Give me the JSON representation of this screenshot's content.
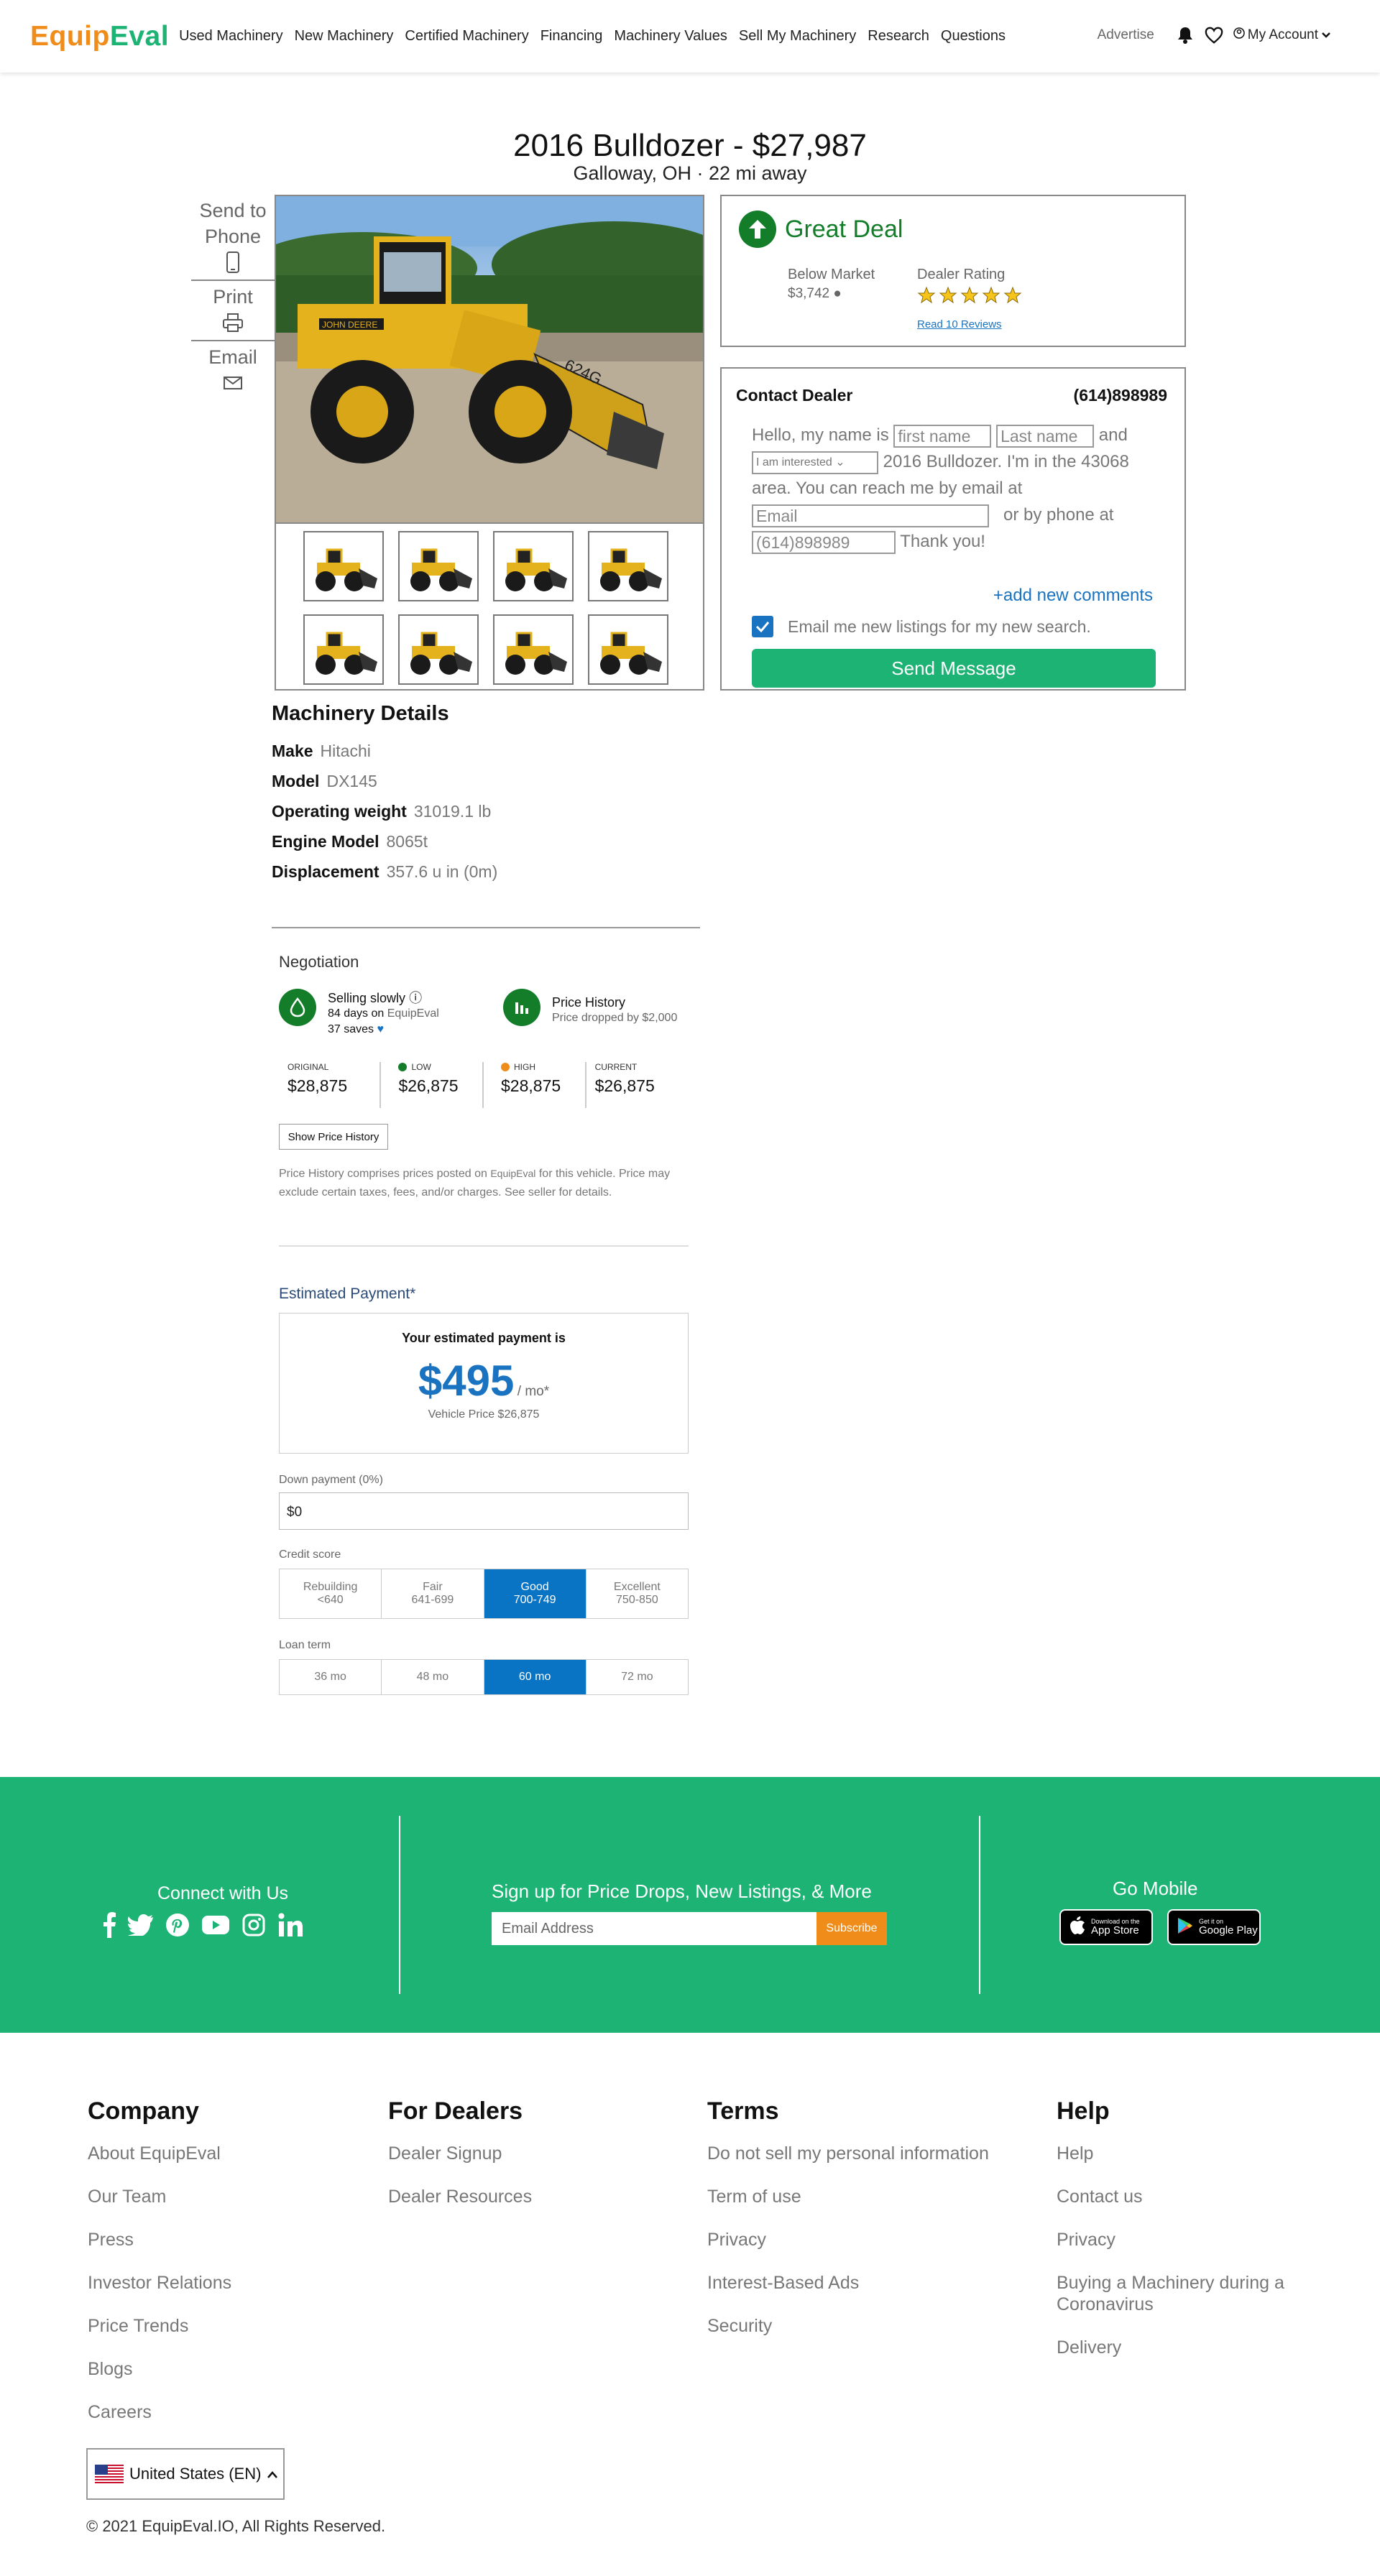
{
  "header": {
    "logo_part1": "Equip",
    "logo_part2": "Eval",
    "nav": [
      "Used Machinery",
      "New Machinery",
      "Certified Machinery",
      "Financing",
      "Machinery Values",
      "Sell My Machinery",
      "Research",
      "Questions"
    ],
    "advertise": "Advertise",
    "account": "My Account"
  },
  "listing": {
    "title": "2016 Bulldozer - $27,987",
    "location": "Galloway, OH · 22 mi away"
  },
  "share": {
    "send_to_phone": "Send to Phone",
    "print": "Print",
    "email": "Email"
  },
  "deal": {
    "label": "Great Deal",
    "below_market_label": "Below Market",
    "below_market_value": "$3,742",
    "dealer_rating_label": "Dealer Rating",
    "rating_stars": 5,
    "reviews_link": "Read 10 Reviews"
  },
  "contact": {
    "heading": "Contact Dealer",
    "phone": "(614)898989",
    "msg_hello": "Hello, my name is",
    "first_name_placeholder": "first name",
    "last_name_placeholder": "Last name",
    "msg_and": "and",
    "interest_select": "I am interested",
    "msg_body": "2016 Bulldozer. I'm in the 43068 area. You can reach me by email at",
    "email_placeholder": "Email",
    "msg_phone": "or by phone at",
    "phone_value": "(614)898989",
    "msg_thanks": "Thank you!",
    "add_comments": "+add new comments",
    "checkbox_label": "Email me new listings for my new search.",
    "send_button": "Send Message"
  },
  "details": {
    "heading": "Machinery Details",
    "rows": [
      {
        "label": "Make",
        "value": "Hitachi"
      },
      {
        "label": "Model",
        "value": "DX145"
      },
      {
        "label": "Operating weight",
        "value": "31019.1 lb"
      },
      {
        "label": "Engine Model",
        "value": "8065t"
      },
      {
        "label": "Displacement",
        "value": "357.6 u in (0m)"
      }
    ]
  },
  "negotiation": {
    "heading": "Negotiation",
    "selling_title": "Selling slowly",
    "selling_days": "84 days",
    "selling_on": "on",
    "selling_site": "EquipEval",
    "selling_saves": "37 saves",
    "history_title": "Price History",
    "history_sub": "Price dropped by $2,000",
    "prices": [
      {
        "label": "ORIGINAL",
        "value": "$28,875",
        "dot": ""
      },
      {
        "label": "LOW",
        "value": "$26,875",
        "dot": "#137d2a"
      },
      {
        "label": "HIGH",
        "value": "$28,875",
        "dot": "#f08c1a"
      },
      {
        "label": "CURRENT",
        "value": "$26,875",
        "dot": ""
      }
    ],
    "show_history_button": "Show Price History",
    "disclaimer_part1": "Price History comprises prices posted on",
    "disclaimer_site": "EquipEval",
    "disclaimer_part2": "for this vehicle. Price may exclude certain taxes, fees, and/or charges. See seller for details."
  },
  "payment": {
    "heading": "Estimated Payment*",
    "box_title": "Your estimated payment is",
    "amount": "$495",
    "per": "/ mo*",
    "vehicle_price": "Vehicle Price $26,875",
    "down_label": "Down payment (0%)",
    "down_value": "$0",
    "credit_label": "Credit score",
    "credit_options": [
      {
        "name": "Rebuilding",
        "range": "<640",
        "active": false
      },
      {
        "name": "Fair",
        "range": "641-699",
        "active": false
      },
      {
        "name": "Good",
        "range": "700-749",
        "active": true
      },
      {
        "name": "Excellent",
        "range": "750-850",
        "active": false
      }
    ],
    "loan_label": "Loan term",
    "loan_options": [
      {
        "name": "36 mo",
        "active": false
      },
      {
        "name": "48 mo",
        "active": false
      },
      {
        "name": "60 mo",
        "active": true
      },
      {
        "name": "72 mo",
        "active": false
      }
    ]
  },
  "band": {
    "connect": "Connect with Us",
    "signup": "Sign up for Price Drops, New Listings, & More",
    "email_placeholder": "Email Address",
    "subscribe": "Subscribe",
    "go_mobile": "Go Mobile",
    "app_store_small": "Download on the",
    "app_store": "App Store",
    "google_small": "Get it on",
    "google": "Google Play"
  },
  "footer": {
    "company": {
      "title": "Company",
      "links": [
        "About EquipEval",
        "Our Team",
        "Press",
        "Investor Relations",
        "Price Trends",
        "Blogs",
        "Careers"
      ]
    },
    "dealers": {
      "title": "For Dealers",
      "links": [
        "Dealer Signup",
        "Dealer Resources"
      ]
    },
    "terms": {
      "title": "Terms",
      "links": [
        "Do not sell my personal information",
        "Term of use",
        "Privacy",
        "Interest-Based Ads",
        "Security"
      ]
    },
    "help": {
      "title": "Help",
      "links": [
        "Help",
        "Contact us",
        "Privacy",
        "Buying a Machinery during a Coronavirus",
        "Delivery"
      ]
    },
    "region": "United States (EN)",
    "copyright": "© 2021 EquipEval.IO, All Rights Reserved."
  },
  "colors": {
    "brand_orange": "#f08c1a",
    "brand_green": "#1db374",
    "deal_green": "#137d2a",
    "link_blue": "#1a73c0"
  }
}
